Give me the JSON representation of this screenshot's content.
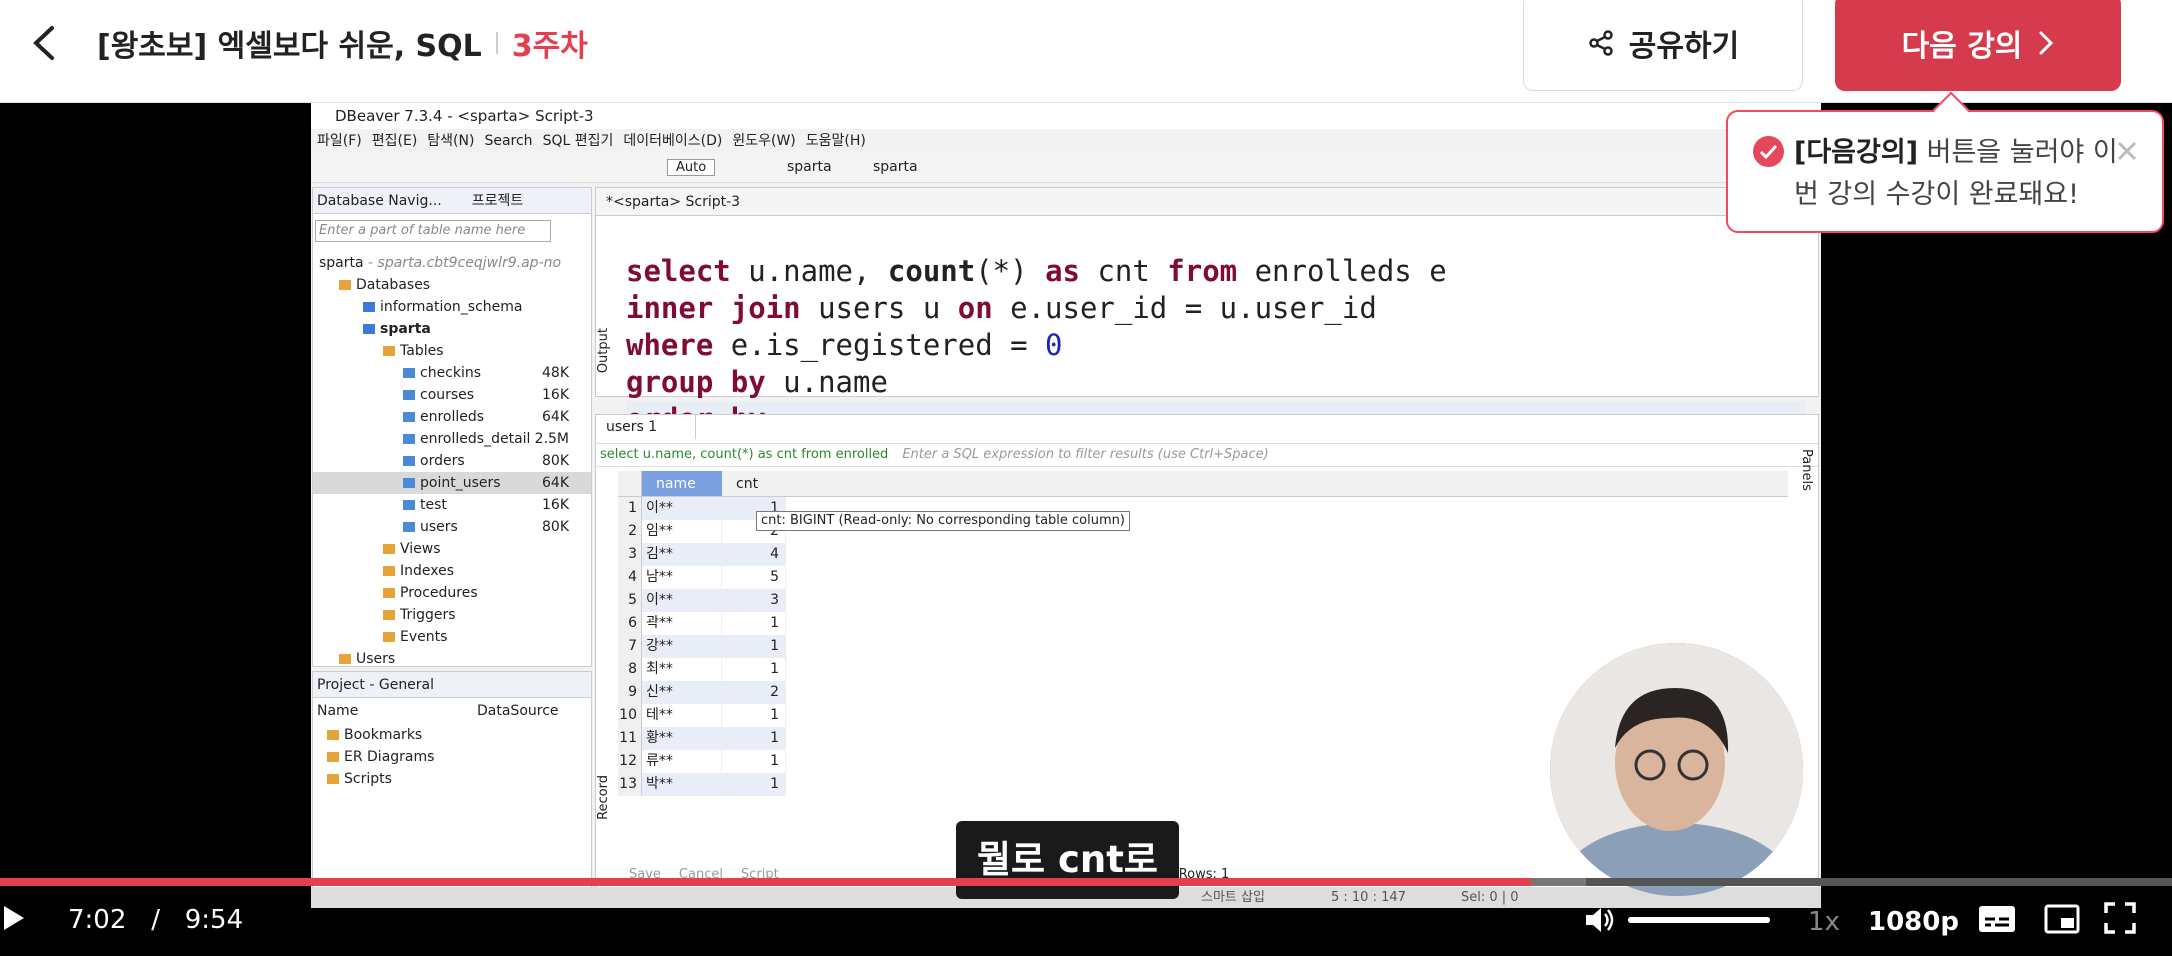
{
  "header": {
    "course_title": "[왕초보] 엑셀보다 쉬운, SQL",
    "week": "3주차",
    "share_label": "공유하기",
    "next_label": "다음 강의"
  },
  "tooltip_notice": {
    "bold": "[다음강의]",
    "text": " 버튼을 눌러야 이번 강의 수강이 완료돼요!"
  },
  "dbeaver": {
    "window_title": "DBeaver 7.3.4 - <sparta> Script-3",
    "menu": [
      "파일(F)",
      "편집(E)",
      "탐색(N)",
      "Search",
      "SQL 편집기",
      "데이터베이스(D)",
      "윈도우(W)",
      "도움말(H)"
    ],
    "toolbar": {
      "auto": "Auto",
      "ds1": "sparta",
      "ds2": "sparta"
    },
    "nav_tab": "Database Navig...",
    "project_tab": "프로젝트",
    "search_placeholder": "Enter a part of table name here",
    "conn": "sparta",
    "conn_host": "- sparta.cbt9ceqjwlr9.ap-no",
    "databases": "Databases",
    "info_schema": "information_schema",
    "db": "sparta",
    "tables_label": "Tables",
    "tables": [
      {
        "name": "checkins",
        "size": "48K"
      },
      {
        "name": "courses",
        "size": "16K"
      },
      {
        "name": "enrolleds",
        "size": "64K"
      },
      {
        "name": "enrolleds_detail",
        "size": "2.5M"
      },
      {
        "name": "orders",
        "size": "80K"
      },
      {
        "name": "point_users",
        "size": "64K"
      },
      {
        "name": "test",
        "size": "16K"
      },
      {
        "name": "users",
        "size": "80K"
      }
    ],
    "folders": [
      "Views",
      "Indexes",
      "Procedures",
      "Triggers",
      "Events"
    ],
    "users_node": "Users",
    "project_panel": "Project - General",
    "project_cols": [
      "Name",
      "DataSource"
    ],
    "project_items": [
      "Bookmarks",
      "ER Diagrams",
      "Scripts"
    ],
    "editor_tab": "*<sparta> Script-3",
    "output_label": "Output",
    "sql_lines": [
      "select u.name, count(*) as cnt from enrolleds e",
      "inner join users u on e.user_id = u.user_id",
      "where e.is_registered = 0",
      "group by u.name",
      "order by"
    ],
    "results_tab": "users 1",
    "filter_query": "select u.name, count(*) as cnt from enrolled",
    "filter_placeholder": "Enter a SQL expression to filter results (use Ctrl+Space)",
    "columns": [
      "name",
      "cnt"
    ],
    "rows": [
      {
        "n": "1",
        "name": "이**",
        "cnt": "1"
      },
      {
        "n": "2",
        "name": "임**",
        "cnt": "2"
      },
      {
        "n": "3",
        "name": "김**",
        "cnt": "4"
      },
      {
        "n": "4",
        "name": "남**",
        "cnt": "5"
      },
      {
        "n": "5",
        "name": "이**",
        "cnt": "3"
      },
      {
        "n": "6",
        "name": "곽**",
        "cnt": "1"
      },
      {
        "n": "7",
        "name": "강**",
        "cnt": "1"
      },
      {
        "n": "8",
        "name": "최**",
        "cnt": "1"
      },
      {
        "n": "9",
        "name": "신**",
        "cnt": "2"
      },
      {
        "n": "10",
        "name": "테**",
        "cnt": "1"
      },
      {
        "n": "11",
        "name": "황**",
        "cnt": "1"
      },
      {
        "n": "12",
        "name": "류**",
        "cnt": "1"
      },
      {
        "n": "13",
        "name": "박**",
        "cnt": "1"
      }
    ],
    "col_tooltip": "cnt: BIGINT (Read-only: No corresponding table column)",
    "side_labels": [
      "Record",
      "Panels"
    ],
    "status_items": [
      "Save",
      "Cancel",
      "Script"
    ],
    "rows_count": "Rows: 1",
    "footer_mode": "스마트 삽입",
    "footer_pos": "5 : 10 : 147",
    "footer_sel": "Sel: 0 | 0"
  },
  "subtitle": "뭘로 cnt로",
  "player": {
    "current": "7:02",
    "divider": "/",
    "duration": "9:54",
    "progress": 0.705,
    "buffered": 0.73,
    "volume": 1.0,
    "speed": "1x",
    "quality": "1080p"
  },
  "colors": {
    "accent": "#e53e4f",
    "button": "#d63b4d",
    "keyword": "#7f0b36"
  }
}
